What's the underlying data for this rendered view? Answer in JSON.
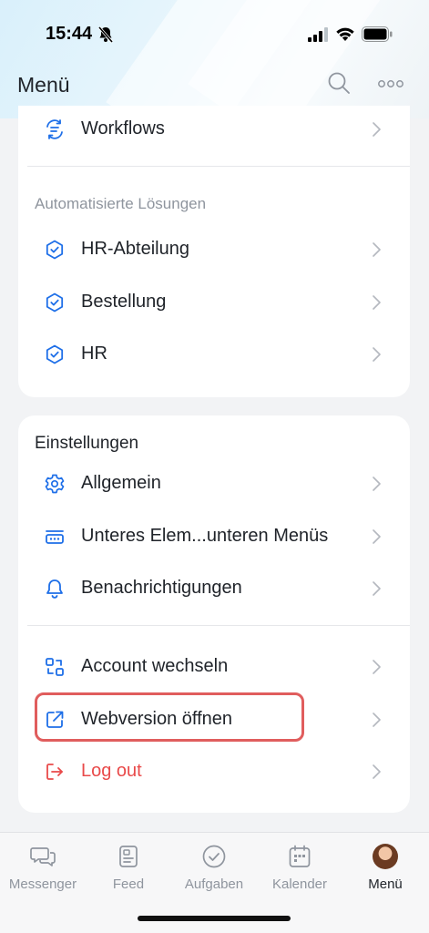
{
  "status_bar": {
    "time": "15:44"
  },
  "header": {
    "title": "Menü"
  },
  "card1": {
    "items": [
      {
        "label": "Workflows",
        "icon": "workflow-icon"
      }
    ],
    "section_title": "Automatisierte Lösungen",
    "solutions": [
      {
        "label": "HR-Abteilung",
        "icon": "hexagon-check-icon"
      },
      {
        "label": "Bestellung",
        "icon": "hexagon-check-icon"
      },
      {
        "label": "HR",
        "icon": "hexagon-check-icon"
      }
    ]
  },
  "card2": {
    "section_title": "Einstellungen",
    "settings": [
      {
        "label": "Allgemein",
        "icon": "gear-icon"
      },
      {
        "label": "Unteres Elem...unteren Menüs",
        "icon": "bottom-menu-icon"
      },
      {
        "label": "Benachrichtigungen",
        "icon": "bell-icon"
      }
    ],
    "account": [
      {
        "label": "Account wechseln",
        "icon": "switch-account-icon"
      },
      {
        "label": "Webversion öffnen",
        "icon": "external-link-icon"
      },
      {
        "label": "Log out",
        "icon": "logout-icon"
      }
    ]
  },
  "tabbar": {
    "tabs": [
      {
        "label": "Messenger",
        "icon": "chat-icon"
      },
      {
        "label": "Feed",
        "icon": "feed-icon"
      },
      {
        "label": "Aufgaben",
        "icon": "task-check-icon"
      },
      {
        "label": "Kalender",
        "icon": "calendar-icon"
      },
      {
        "label": "Menü",
        "icon": "avatar",
        "active": true
      }
    ]
  },
  "colors": {
    "accent": "#1e6fe8",
    "danger": "#e94a4a",
    "highlight": "#e05d5d"
  }
}
